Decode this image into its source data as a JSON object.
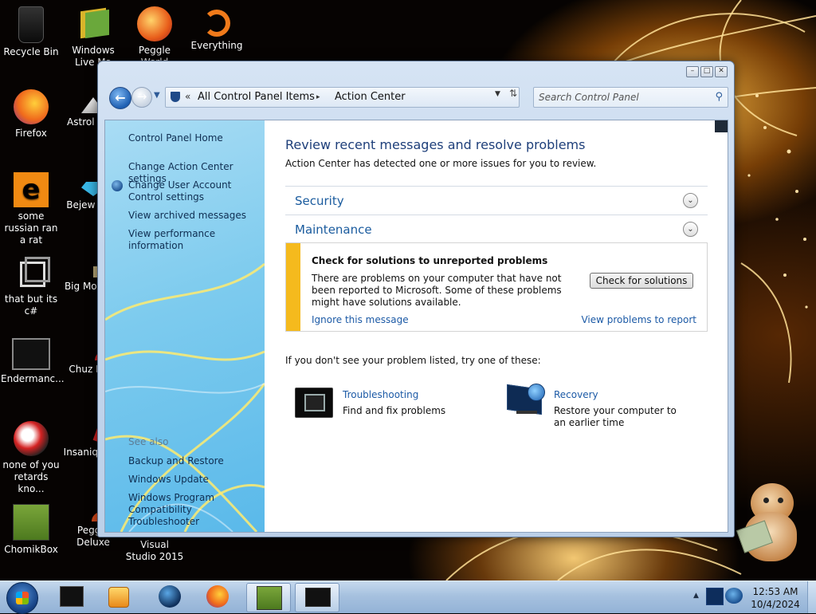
{
  "desktop": {
    "icons": [
      {
        "label": "Recycle Bin",
        "icon": "recycle-bin-icon"
      },
      {
        "label": "Windows Live Ma",
        "icon": "windows-live-icon"
      },
      {
        "label": "Peggle World",
        "icon": "peggle-world-icon"
      },
      {
        "label": "Everything",
        "icon": "everything-icon"
      },
      {
        "label": "Firefox",
        "icon": "firefox-icon"
      },
      {
        "label": "Astrol Delu",
        "icon": "astrol-deluxe-icon"
      },
      {
        "label": "some russian ran a rat",
        "icon": "e-app-icon"
      },
      {
        "label": "Bejew Delu",
        "icon": "bejeweled-icon"
      },
      {
        "label": "that but its c#",
        "icon": "shortcut-icon"
      },
      {
        "label": "Big Mo Delu",
        "icon": "big-money-icon"
      },
      {
        "label": "Endermanc...",
        "icon": "enderman-icon"
      },
      {
        "label": "Chuz Delu",
        "icon": "chuzzle-icon"
      },
      {
        "label": "none of you retards kno...",
        "icon": "red-app-icon"
      },
      {
        "label": "Insaniq Delu",
        "icon": "insaniquarium-icon"
      },
      {
        "label": "ChomikBox",
        "icon": "chomikbox-icon"
      },
      {
        "label": "Peggle Deluxe",
        "icon": "peggle-deluxe-icon"
      },
      {
        "label": "Visual Studio 2015",
        "icon": "visual-studio-icon"
      }
    ]
  },
  "window": {
    "address": {
      "crumbs": [
        "All Control Panel Items",
        "Action Center"
      ],
      "overflow": "«",
      "separator": "▸"
    },
    "search": {
      "placeholder": "Search Control Panel"
    },
    "caption": {
      "minimize": "–",
      "maximize": "□",
      "close": "✕"
    }
  },
  "sidebar": {
    "home": "Control Panel Home",
    "links": [
      "Change Action Center settings",
      "Change User Account Control settings",
      "View archived messages",
      "View performance information"
    ],
    "see_also_title": "See also",
    "see_also": [
      "Backup and Restore",
      "Windows Update",
      "Windows Program Compatibility Troubleshooter"
    ]
  },
  "main": {
    "title": "Review recent messages and resolve problems",
    "subtitle": "Action Center has detected one or more issues for you to review.",
    "sections": [
      "Security",
      "Maintenance"
    ],
    "alert": {
      "title": "Check for solutions to unreported problems",
      "body": "There are problems on your computer that have not been reported to Microsoft. Some of these problems might have solutions available.",
      "button": "Check for solutions",
      "ignore": "Ignore this message",
      "view": "View problems to report",
      "accent_color": "#f5ba1d"
    },
    "try_text": "If you don't see your problem listed, try one of these:",
    "tasks": [
      {
        "title": "Troubleshooting",
        "desc": "Find and fix problems"
      },
      {
        "title": "Recovery",
        "desc": "Restore your computer to an earlier time"
      }
    ]
  },
  "taskbar": {
    "items": [
      "app-dark-icon",
      "media-player-icon",
      "globe-icon",
      "firefox-icon",
      "chomikbox-icon",
      "monitor-icon"
    ],
    "clock_time": "12:53 AM",
    "clock_date": "10/4/2024"
  }
}
